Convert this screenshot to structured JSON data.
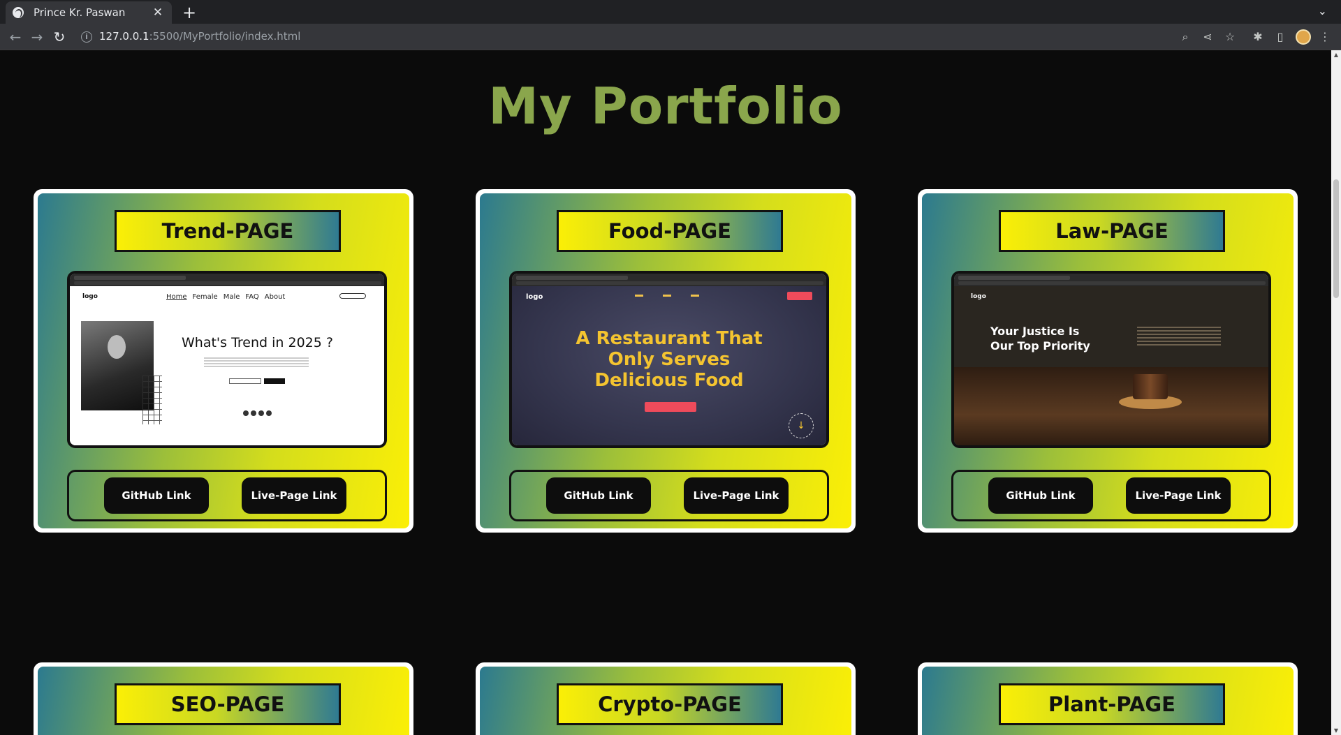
{
  "browser": {
    "tab_title": "Prince Kr. Paswan",
    "url_host": "127.0.0.1",
    "url_rest": ":5500/MyPortfolio/index.html"
  },
  "page": {
    "title": "My Portfolio"
  },
  "projects": [
    {
      "title": "Trend-PAGE",
      "github_label": "GitHub Link",
      "live_label": "Live-Page Link",
      "preview": {
        "logo": "logo",
        "nav": [
          "Home",
          "Female",
          "Male",
          "FAQ",
          "About"
        ],
        "heading": "What's Trend in 2025 ?"
      }
    },
    {
      "title": "Food-PAGE",
      "github_label": "GitHub Link",
      "live_label": "Live-Page Link",
      "preview": {
        "logo": "logo",
        "heading_lines": [
          "A Restaurant That",
          "Only Serves",
          "Delicious Food"
        ]
      }
    },
    {
      "title": "Law-PAGE",
      "github_label": "GitHub Link",
      "live_label": "Live-Page Link",
      "preview": {
        "logo": "logo",
        "heading_lines": [
          "Your Justice Is",
          "Our Top Priority"
        ]
      }
    },
    {
      "title": "SEO-PAGE"
    },
    {
      "title": "Crypto-PAGE"
    },
    {
      "title": "Plant-PAGE"
    }
  ],
  "colors": {
    "title": "#8aa64c",
    "card_gradient_start": "#2c7a8f",
    "card_gradient_end": "#fbef06",
    "button_bg": "#0d0d0d"
  }
}
